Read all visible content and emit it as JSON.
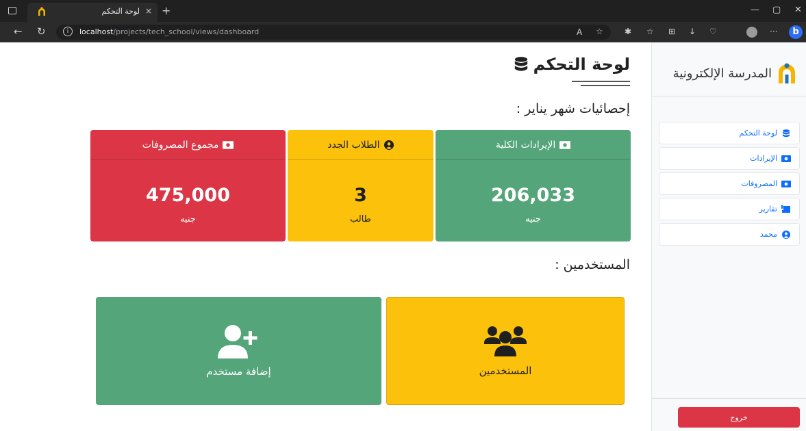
{
  "browser": {
    "tab_title": "لوحة التحكم",
    "close_glyph": "×",
    "new_tab_glyph": "+",
    "url_host": "localhost",
    "url_path": "/projects/tech_school/views/dashboard",
    "bing_glyph": "b"
  },
  "sidebar": {
    "brand_name": "المدرسة الإلكترونية",
    "items": [
      {
        "label": "لوحة التحكم",
        "icon": "database-icon"
      },
      {
        "label": "الإيرادات",
        "icon": "money-icon"
      },
      {
        "label": "المصروفات",
        "icon": "money-icon"
      },
      {
        "label": "تقارير",
        "icon": "report-icon"
      },
      {
        "label": "محمد",
        "icon": "user-circle-icon"
      }
    ],
    "logout_label": "خروج"
  },
  "main": {
    "title": "لوحة التحكم",
    "stats_heading": "إحصائيات شهر يناير :",
    "users_heading": "المستخدمين :",
    "cards": [
      {
        "title": "الإيرادات الكلية",
        "value": "206,033",
        "unit": "جنيه",
        "color": "#55a57a"
      },
      {
        "title": "الطلاب الجدد",
        "value": "3",
        "unit": "طالب",
        "color": "#fcc10a"
      },
      {
        "title": "مجموع المصروفات",
        "value": "475,000",
        "unit": "جنيه",
        "color": "#dc3545"
      }
    ],
    "tiles": {
      "users_label": "المستخدمين",
      "add_user_label": "إضافة مستخدم"
    }
  }
}
